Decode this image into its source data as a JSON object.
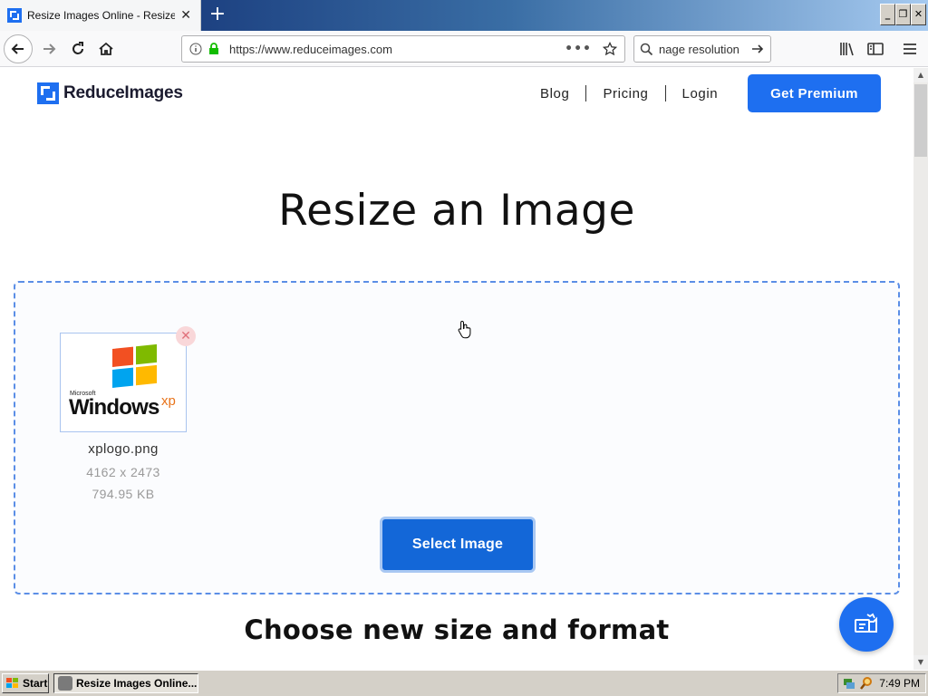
{
  "browser": {
    "tab_title": "Resize Images Online - Resize JPG",
    "tab_close": "✕",
    "new_tab": "+",
    "url": "https://www.reduceimages.com",
    "url_actions": "•••",
    "search_text": "nage resolution",
    "window_buttons": [
      "_",
      "❐",
      "✕"
    ]
  },
  "site": {
    "logo_text": "ReduceImages",
    "nav": [
      "Blog",
      "Pricing",
      "Login"
    ],
    "cta_label": "Get Premium",
    "accent_color": "#1e6ff0"
  },
  "main": {
    "title": "Resize an Image",
    "file": {
      "name": "xplogo.png",
      "dimensions": "4162 x 2473",
      "size": "794.95 KB",
      "thumb_small_text": "Microsoft",
      "thumb_brand": "Windows",
      "thumb_sup": "xp"
    },
    "select_button": "Select Image",
    "section_title": "Choose new size and format"
  },
  "taskbar": {
    "start_label": "Start",
    "task_label": "Resize Images Online...",
    "clock": "7:49 PM"
  }
}
